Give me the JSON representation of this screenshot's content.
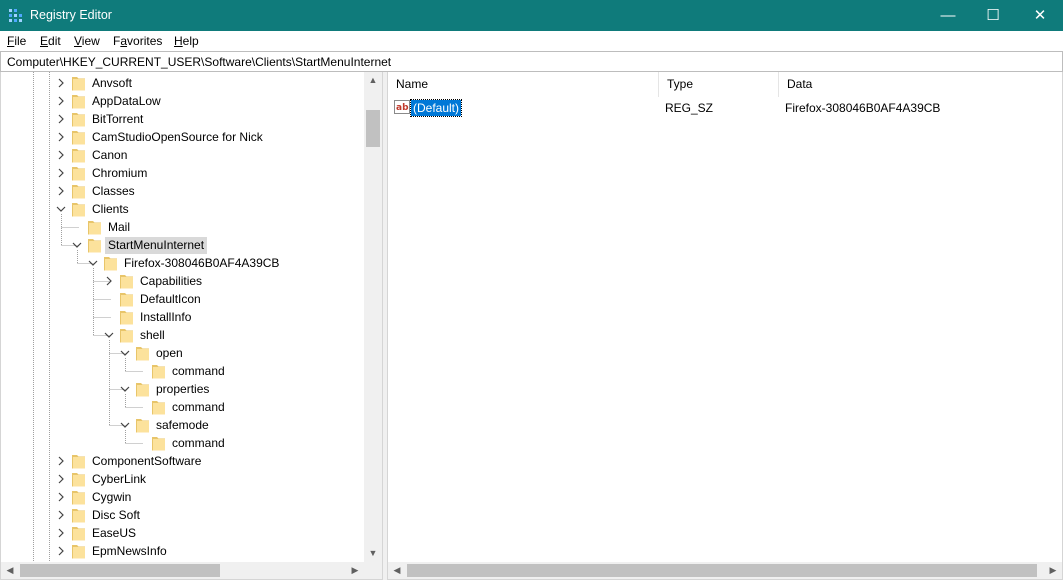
{
  "window": {
    "title": "Registry Editor",
    "titlebar_color": "#0f7b7b",
    "app_icon": "registry-editor-icon",
    "minimize_glyph": "—",
    "maximize_glyph": "☐",
    "close_glyph": "✕"
  },
  "menu": [
    {
      "label": "File",
      "accel": "F",
      "rest": "ile"
    },
    {
      "label": "Edit",
      "accel": "E",
      "rest": "dit"
    },
    {
      "label": "View",
      "accel": "V",
      "rest": "iew"
    },
    {
      "label": "Favorites",
      "accel": "a",
      "pre": "F",
      "rest": "vorites"
    },
    {
      "label": "Help",
      "accel": "H",
      "rest": "elp"
    }
  ],
  "address": {
    "path": "Computer\\HKEY_CURRENT_USER\\Software\\Clients\\StartMenuInternet"
  },
  "tree": {
    "folder_icon": "folder-icon",
    "nodes": [
      {
        "label": "Anvsoft",
        "depth": 0,
        "state": "collapsed"
      },
      {
        "label": "AppDataLow",
        "depth": 0,
        "state": "collapsed"
      },
      {
        "label": "BitTorrent",
        "depth": 0,
        "state": "collapsed"
      },
      {
        "label": "CamStudioOpenSource for Nick",
        "depth": 0,
        "state": "collapsed"
      },
      {
        "label": "Canon",
        "depth": 0,
        "state": "collapsed"
      },
      {
        "label": "Chromium",
        "depth": 0,
        "state": "collapsed"
      },
      {
        "label": "Classes",
        "depth": 0,
        "state": "collapsed"
      },
      {
        "label": "Clients",
        "depth": 0,
        "state": "expanded"
      },
      {
        "label": "Mail",
        "depth": 1,
        "state": "leaf"
      },
      {
        "label": "StartMenuInternet",
        "depth": 1,
        "state": "expanded",
        "selected": true
      },
      {
        "label": "Firefox-308046B0AF4A39CB",
        "depth": 2,
        "state": "expanded"
      },
      {
        "label": "Capabilities",
        "depth": 3,
        "state": "collapsed"
      },
      {
        "label": "DefaultIcon",
        "depth": 3,
        "state": "leaf"
      },
      {
        "label": "InstallInfo",
        "depth": 3,
        "state": "leaf"
      },
      {
        "label": "shell",
        "depth": 3,
        "state": "expanded"
      },
      {
        "label": "open",
        "depth": 4,
        "state": "expanded"
      },
      {
        "label": "command",
        "depth": 5,
        "state": "leaf"
      },
      {
        "label": "properties",
        "depth": 4,
        "state": "expanded"
      },
      {
        "label": "command",
        "depth": 5,
        "state": "leaf"
      },
      {
        "label": "safemode",
        "depth": 4,
        "state": "expanded"
      },
      {
        "label": "command",
        "depth": 5,
        "state": "leaf"
      },
      {
        "label": "ComponentSoftware",
        "depth": 0,
        "state": "collapsed"
      },
      {
        "label": "CyberLink",
        "depth": 0,
        "state": "collapsed"
      },
      {
        "label": "Cygwin",
        "depth": 0,
        "state": "collapsed"
      },
      {
        "label": "Disc Soft",
        "depth": 0,
        "state": "collapsed"
      },
      {
        "label": "EaseUS",
        "depth": 0,
        "state": "collapsed"
      },
      {
        "label": "EpmNewsInfo",
        "depth": 0,
        "state": "collapsed"
      }
    ]
  },
  "list": {
    "columns": {
      "name": "Name",
      "type": "Type",
      "data": "Data"
    },
    "rows": [
      {
        "name": "(Default)",
        "type": "REG_SZ",
        "data": "Firefox-308046B0AF4A39CB",
        "icon": "string-value-icon",
        "icon_text": "ab"
      }
    ],
    "selection_color": "#0078d7"
  },
  "scrollbars": {
    "up_glyph": "▲",
    "down_glyph": "▼",
    "left_glyph": "◀",
    "right_glyph": "▶"
  }
}
